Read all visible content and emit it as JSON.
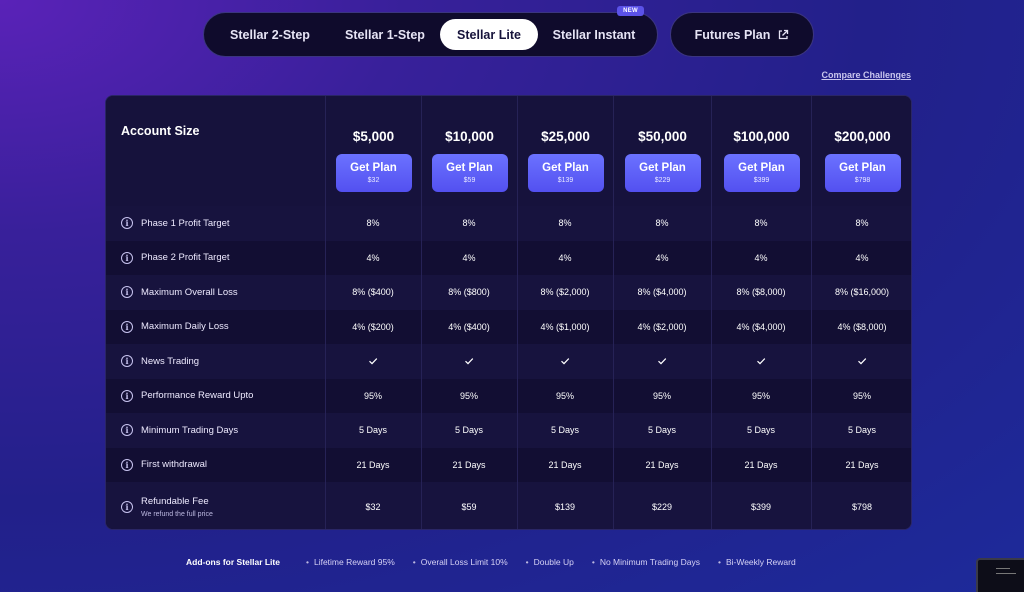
{
  "tabs": [
    {
      "label": "Stellar 2-Step"
    },
    {
      "label": "Stellar 1-Step"
    },
    {
      "label": "Stellar Lite",
      "active": true
    },
    {
      "label": "Stellar Instant",
      "badge": "NEW"
    }
  ],
  "futures": {
    "label": "Futures Plan",
    "icon": "external-link-icon"
  },
  "compare_link": "Compare Challenges",
  "table": {
    "account_size_label": "Account Size",
    "button_label": "Get Plan",
    "columns": [
      {
        "size": "$5,000",
        "price": "$32"
      },
      {
        "size": "$10,000",
        "price": "$59"
      },
      {
        "size": "$25,000",
        "price": "$139"
      },
      {
        "size": "$50,000",
        "price": "$229"
      },
      {
        "size": "$100,000",
        "price": "$399"
      },
      {
        "size": "$200,000",
        "price": "$798"
      }
    ],
    "rows": [
      {
        "label": "Phase 1 Profit Target",
        "values": [
          "8%",
          "8%",
          "8%",
          "8%",
          "8%",
          "8%"
        ]
      },
      {
        "label": "Phase 2 Profit Target",
        "values": [
          "4%",
          "4%",
          "4%",
          "4%",
          "4%",
          "4%"
        ]
      },
      {
        "label": "Maximum Overall Loss",
        "values": [
          "8% ($400)",
          "8% ($800)",
          "8% ($2,000)",
          "8% ($4,000)",
          "8% ($8,000)",
          "8% ($16,000)"
        ]
      },
      {
        "label": "Maximum Daily Loss",
        "values": [
          "4% ($200)",
          "4% ($400)",
          "4% ($1,000)",
          "4% ($2,000)",
          "4% ($4,000)",
          "4% ($8,000)"
        ]
      },
      {
        "label": "News Trading",
        "check": true
      },
      {
        "label": "Performance Reward Upto",
        "values": [
          "95%",
          "95%",
          "95%",
          "95%",
          "95%",
          "95%"
        ]
      },
      {
        "label": "Minimum Trading Days",
        "values": [
          "5 Days",
          "5 Days",
          "5 Days",
          "5 Days",
          "5 Days",
          "5 Days"
        ]
      },
      {
        "label": "First withdrawal",
        "values": [
          "21 Days",
          "21 Days",
          "21 Days",
          "21 Days",
          "21 Days",
          "21 Days"
        ]
      },
      {
        "label": "Refundable Fee",
        "sublabel": "We refund the full price",
        "values": [
          "$32",
          "$59",
          "$139",
          "$229",
          "$399",
          "$798"
        ]
      }
    ]
  },
  "addons": {
    "title": "Add-ons for Stellar Lite",
    "items": [
      "Lifetime Reward 95%",
      "Overall Loss Limit 10%",
      "Double Up",
      "No Minimum Trading Days",
      "Bi-Weekly Reward"
    ]
  }
}
